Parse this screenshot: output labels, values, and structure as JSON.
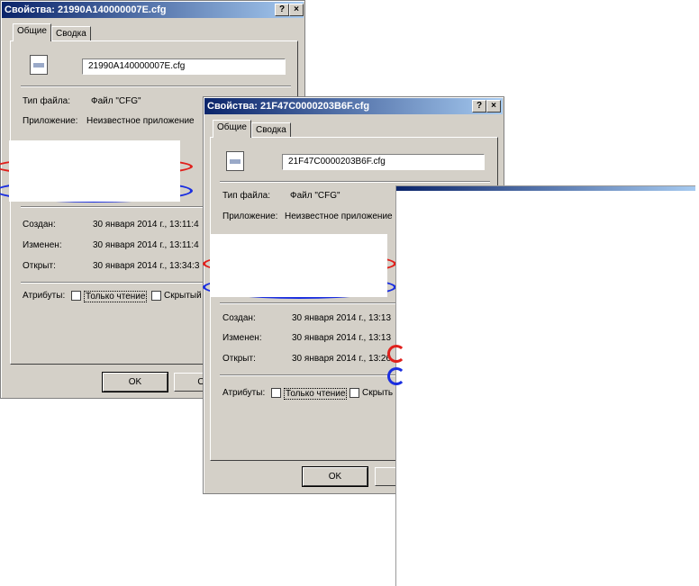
{
  "dialog1": {
    "title": "Свойства: 21990A140000007E.cfg",
    "help_btn": "?",
    "close_btn": "×",
    "tab_general": "Общие",
    "tab_summary": "Сводка",
    "filename": "21990A140000007E.cfg",
    "type_label": "Тип файла:",
    "type_value": "Файл \"CFG\"",
    "app_label": "Приложение:",
    "app_value": "Неизвестное приложение",
    "created_label": "Создан:",
    "created_value": "30 января 2014 г., 13:11:4",
    "modified_label": "Изменен:",
    "modified_value": "30 января 2014 г., 13:11:4",
    "opened_label": "Открыт:",
    "opened_value": "30 января 2014 г., 13:34:3",
    "attributes_label": "Атрибуты:",
    "readonly_label": "Только чтение",
    "hidden_label": "Скрытый",
    "ok_label": "OK",
    "cancel_label": "Отм"
  },
  "dialog2": {
    "title": "Свойства: 21F47C0000203B6F.cfg",
    "help_btn": "?",
    "close_btn": "×",
    "tab_general": "Общие",
    "tab_summary": "Сводка",
    "filename": "21F47C0000203B6F.cfg",
    "type_label": "Тип файла:",
    "type_value": "Файл \"CFG\"",
    "app_label": "Приложение:",
    "app_value": "Неизвестное приложение",
    "created_label": "Создан:",
    "created_value": "30 января 2014 г., 13:13",
    "modified_label": "Изменен:",
    "modified_value": "30 января 2014 г., 13:13",
    "opened_label": "Открыт:",
    "opened_value": "30 января 2014 г., 13:26",
    "attributes_label": "Атрибуты:",
    "readonly_label": "Только чтение",
    "hidden_label": "Скрыть",
    "ok_label": "OK",
    "cancel_label": "От"
  },
  "colors": {
    "title_start": "#0a246a",
    "title_end": "#a6caf0",
    "window_face": "#d4d0c8",
    "marker_red": "#e0201c",
    "marker_blue": "#1a2ee0"
  }
}
